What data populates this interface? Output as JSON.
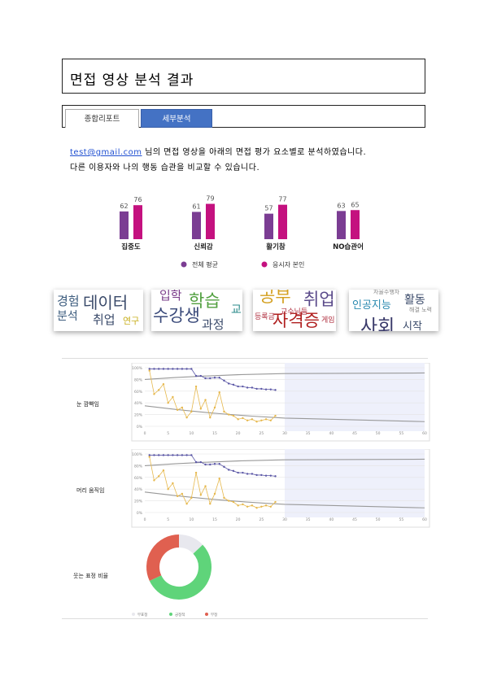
{
  "report": {
    "title": "면접 영상 분석 결과",
    "tabs": [
      "종합리포트",
      "세부분석"
    ],
    "email": "test@gmail.com",
    "intro_line1_rest": " 님의 면접 영상을 아래의 면접 평가 요소별로 분석하였습니다.",
    "intro_line2": "다른 이용자와 나의 행동 습관을 비교할 수 있습니다."
  },
  "colors": {
    "average": "#7b3d93",
    "user": "#c4117f",
    "tab_active": "#4472c4"
  },
  "chart_data": [
    {
      "type": "bar",
      "categories": [
        "집중도",
        "신뢰감",
        "활기참",
        "NO습관어"
      ],
      "series": [
        {
          "name": "전체 평균",
          "values": [
            62,
            61,
            57,
            63
          ]
        },
        {
          "name": "응시자 본인",
          "values": [
            76,
            79,
            77,
            65
          ]
        }
      ],
      "legend": "bottom"
    },
    {
      "type": "line",
      "title": "눈 깜빡임",
      "y_ticks": [
        "100%",
        "80%",
        "60%",
        "40%",
        "20%",
        "0%"
      ],
      "x_ticks": [
        0,
        5,
        10,
        15,
        20,
        25,
        30,
        35,
        40,
        45,
        50,
        55,
        60
      ],
      "series": [
        {
          "color": "#5b57a6",
          "values": [
            98,
            98,
            98,
            98,
            98,
            98,
            98,
            98,
            98,
            98,
            86,
            86,
            82,
            82,
            83,
            83,
            78,
            73,
            71,
            68,
            68,
            66,
            66,
            64,
            64,
            63,
            63,
            62
          ]
        },
        {
          "color": "#e6b84d",
          "values": [
            95,
            55,
            62,
            72,
            40,
            50,
            28,
            32,
            15,
            25,
            68,
            30,
            45,
            15,
            32,
            58,
            25,
            20,
            18,
            12,
            14,
            10,
            12,
            8,
            10,
            12,
            10,
            18
          ]
        }
      ]
    },
    {
      "type": "line",
      "title": "머리 움직임",
      "y_ticks": [
        "100%",
        "80%",
        "60%",
        "40%",
        "20%",
        "0%"
      ],
      "x_ticks": [
        0,
        5,
        10,
        15,
        20,
        25,
        30,
        35,
        40,
        45,
        50,
        55,
        60
      ],
      "series": [
        {
          "color": "#5b57a6",
          "values": [
            98,
            98,
            98,
            98,
            98,
            98,
            98,
            98,
            98,
            98,
            86,
            86,
            82,
            82,
            83,
            83,
            78,
            73,
            71,
            68,
            68,
            66,
            66,
            64,
            64,
            63,
            63,
            62
          ]
        },
        {
          "color": "#e6b84d",
          "values": [
            95,
            55,
            62,
            72,
            40,
            50,
            28,
            32,
            15,
            25,
            68,
            30,
            45,
            15,
            32,
            58,
            25,
            20,
            18,
            12,
            14,
            10,
            12,
            8,
            10,
            12,
            10,
            18
          ]
        }
      ]
    },
    {
      "type": "pie",
      "title": "웃는 표정 비율",
      "labels": [
        "무표정",
        "긍정적",
        "부정"
      ],
      "values": [
        13,
        55,
        32
      ],
      "colors": [
        "#e8e8ee",
        "#5fd47a",
        "#e06050"
      ]
    }
  ],
  "clouds": [
    {
      "words": [
        {
          "t": "경험",
          "c": "#3a5a7c",
          "fs": 15
        },
        {
          "t": "데이터",
          "c": "#3a4a6a",
          "fs": 20
        },
        {
          "t": "분석",
          "c": "#3a5a7c",
          "fs": 14
        },
        {
          "t": "취업",
          "c": "#3a4a6a",
          "fs": 15
        },
        {
          "t": "연구",
          "c": "#c8b020",
          "fs": 11
        }
      ]
    },
    {
      "words": [
        {
          "t": "입학",
          "c": "#7a3c8a",
          "fs": 15
        },
        {
          "t": "학습",
          "c": "#52a040",
          "fs": 21
        },
        {
          "t": "수강생",
          "c": "#3a4a7a",
          "fs": 21
        },
        {
          "t": "과정",
          "c": "#3a4a6a",
          "fs": 15
        },
        {
          "t": "교",
          "c": "#2a8a8a",
          "fs": 14
        }
      ]
    },
    {
      "words": [
        {
          "t": "공부",
          "c": "#d4a020",
          "fs": 21
        },
        {
          "t": "취업",
          "c": "#5a4a8a",
          "fs": 21
        },
        {
          "t": "교수님들",
          "c": "#b03040",
          "fs": 9
        },
        {
          "t": "자격증",
          "c": "#b02020",
          "fs": 21
        },
        {
          "t": "등록금",
          "c": "#b03040",
          "fs": 9
        },
        {
          "t": "게임",
          "c": "#b03040",
          "fs": 9
        }
      ]
    },
    {
      "words": [
        {
          "t": "자율주행차",
          "c": "#888",
          "fs": 7
        },
        {
          "t": "활동",
          "c": "#3a4a6a",
          "fs": 14
        },
        {
          "t": "인공지능",
          "c": "#2a8ab0",
          "fs": 13
        },
        {
          "t": "사회",
          "c": "#3a3a6a",
          "fs": 23
        },
        {
          "t": "시작",
          "c": "#3a4a6a",
          "fs": 13
        },
        {
          "t": "해결 노력",
          "c": "#888",
          "fs": 7
        }
      ]
    }
  ]
}
